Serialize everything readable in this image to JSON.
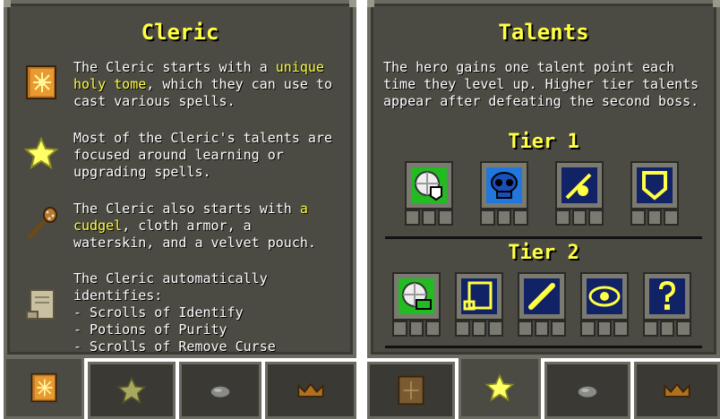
{
  "left_panel": {
    "title": "Cleric",
    "rows": [
      {
        "icon": "holy-tome-icon",
        "before": "The Cleric starts with a ",
        "highlight": "unique holy tome",
        "after": ", which they can use to cast various spells."
      },
      {
        "icon": "star-icon",
        "text": "Most of the Cleric's talents are focused around learning or upgrading spells."
      },
      {
        "icon": "cudgel-icon",
        "before": "The Cleric also starts with ",
        "highlight": "a cudgel",
        "after": ", cloth armor, a waterskin, and a velvet pouch."
      },
      {
        "icon": "scroll-icon",
        "lines": [
          "The Cleric automatically identifies:",
          "- Scrolls of Identify",
          "- Potions of Purity",
          "- Scrolls of Remove Curse"
        ]
      }
    ],
    "tabs": [
      "holy-tome-icon",
      "star-icon",
      "stone-icon",
      "crown-icon"
    ],
    "active_tab": 0
  },
  "right_panel": {
    "title": "Talents",
    "intro": "The hero gains one talent point each time they level up. Higher tier talents appear after defeating the second boss.",
    "tier1_label": "Tier 1",
    "tier2_label": "Tier 2",
    "tier1": [
      {
        "icon": "shield-plate-icon",
        "bg": "#22bb22"
      },
      {
        "icon": "blue-skull-icon",
        "bg": "#2277dd"
      },
      {
        "icon": "wand-spark-icon",
        "bg": "#112266"
      },
      {
        "icon": "shield-outline-icon",
        "bg": "#112266"
      }
    ],
    "tier2": [
      {
        "icon": "plate-scroll-icon",
        "bg": "#22bb22"
      },
      {
        "icon": "scroll-outline-icon",
        "bg": "#112266"
      },
      {
        "icon": "wand-icon",
        "bg": "#112266"
      },
      {
        "icon": "eye-icon",
        "bg": "#112266"
      },
      {
        "icon": "question-key-icon",
        "bg": "#112266"
      }
    ],
    "tabs": [
      "holy-tome-icon",
      "star-icon",
      "stone-icon",
      "crown-icon"
    ],
    "active_tab": 1
  }
}
